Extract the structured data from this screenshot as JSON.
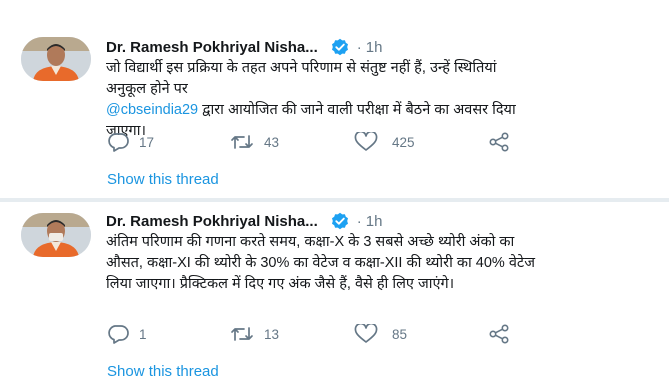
{
  "tweets": [
    {
      "author": "Dr. Ramesh Pokhriyal Nisha...",
      "separator": "·",
      "time": "1h",
      "text_before": "जो विद्यार्थी इस प्रक्रिया के तहत अपने परिणाम से संतुष्ट नहीं हैं, उन्हें स्थितियां अनुकूल होने पर",
      "mention": "@cbseindia29",
      "text_after": " द्वारा आयोजित की जाने वाली परीक्षा में बैठने का अवसर दिया जाएगा।",
      "replies": "17",
      "retweets": "43",
      "likes": "425",
      "show_thread": "Show this thread"
    },
    {
      "author": "Dr. Ramesh Pokhriyal Nisha...",
      "separator": "·",
      "time": "1h",
      "text": "अंतिम परिणाम की गणना करते समय, कक्षा-X के 3 सबसे अच्छे थ्योरी अंको का औसत, कक्षा-XI की थ्योरी के 30% का वेटेज व कक्षा-XII की थ्योरी का 40% वेटेज लिया जाएगा। प्रैक्टिकल में दिए गए अंक जैसे हैं, वैसे ही लिए जाएंगे।",
      "replies": "1",
      "retweets": "13",
      "likes": "85",
      "show_thread": "Show this thread"
    }
  ],
  "icons": {
    "verified": "verified-badge-icon",
    "reply": "reply-icon",
    "retweet": "retweet-icon",
    "like": "heart-icon",
    "share": "share-icon"
  },
  "colors": {
    "accent": "#1b95e0",
    "muted": "#657786",
    "text": "#14171a"
  }
}
